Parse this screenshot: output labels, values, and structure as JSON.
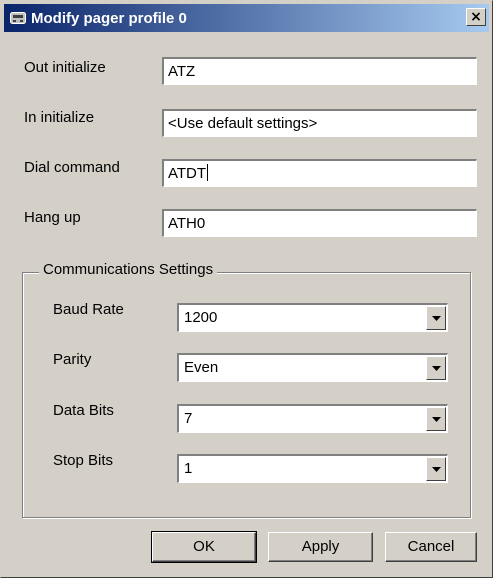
{
  "window": {
    "title": "Modify pager profile 0",
    "close_glyph": "×",
    "icon": "pager-icon"
  },
  "fields": {
    "out_initialize": {
      "label": "Out initialize",
      "value": "ATZ"
    },
    "in_initialize": {
      "label": "In initialize",
      "value": "<Use default settings>"
    },
    "dial_command": {
      "label": "Dial command",
      "value": "ATDT"
    },
    "hang_up": {
      "label": "Hang up",
      "value": "ATH0"
    }
  },
  "comm": {
    "title": "Communications Settings",
    "baud_rate": {
      "label": "Baud Rate",
      "value": "1200"
    },
    "parity": {
      "label": "Parity",
      "value": "Even"
    },
    "data_bits": {
      "label": "Data Bits",
      "value": "7"
    },
    "stop_bits": {
      "label": "Stop Bits",
      "value": "1"
    }
  },
  "buttons": {
    "ok": "OK",
    "apply": "Apply",
    "cancel": "Cancel"
  },
  "colors": {
    "titlebar_start": "#0a246a",
    "titlebar_end": "#a6caf0",
    "face": "#d4d0c8"
  }
}
